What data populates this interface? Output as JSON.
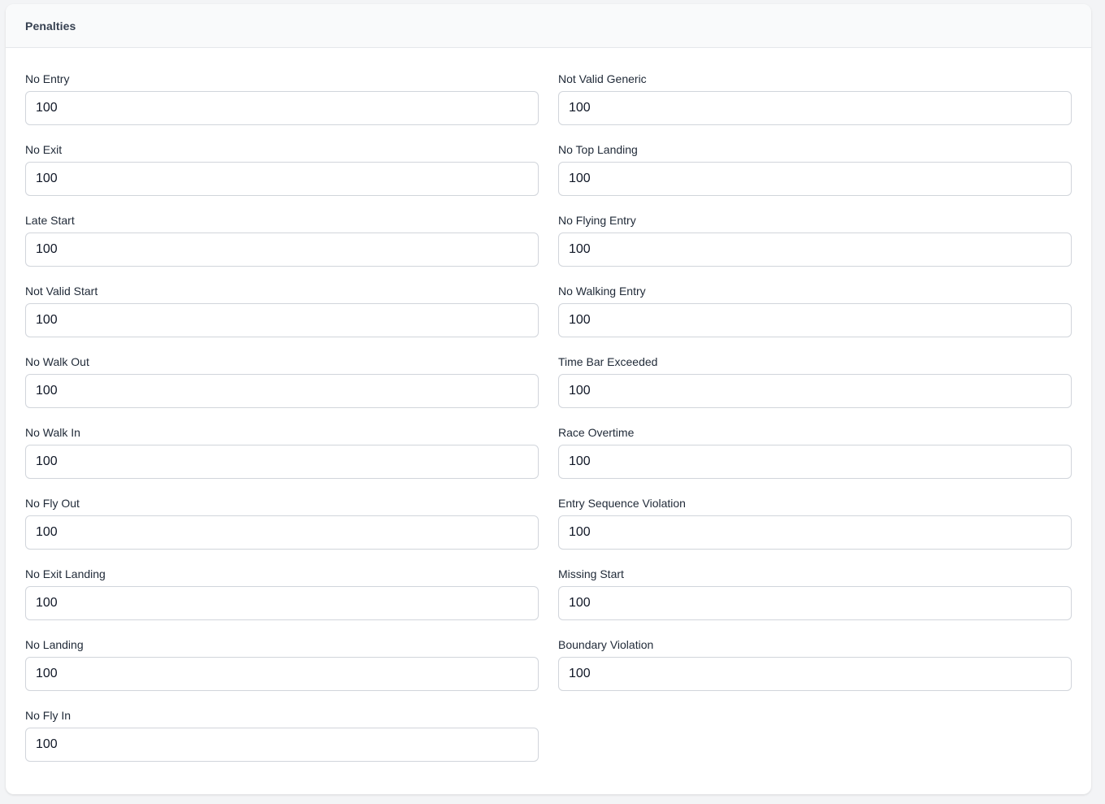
{
  "card": {
    "title": "Penalties"
  },
  "left_fields": [
    {
      "label": "No Entry",
      "value": "100"
    },
    {
      "label": "No Exit",
      "value": "100"
    },
    {
      "label": "Late Start",
      "value": "100"
    },
    {
      "label": "Not Valid Start",
      "value": "100"
    },
    {
      "label": "No Walk Out",
      "value": "100"
    },
    {
      "label": "No Walk In",
      "value": "100"
    },
    {
      "label": "No Fly Out",
      "value": "100"
    },
    {
      "label": "No Exit Landing",
      "value": "100"
    },
    {
      "label": "No Landing",
      "value": "100"
    },
    {
      "label": "No Fly In",
      "value": "100"
    }
  ],
  "right_fields": [
    {
      "label": "Not Valid Generic",
      "value": "100"
    },
    {
      "label": "No Top Landing",
      "value": "100"
    },
    {
      "label": "No Flying Entry",
      "value": "100"
    },
    {
      "label": "No Walking Entry",
      "value": "100"
    },
    {
      "label": "Time Bar Exceeded",
      "value": "100"
    },
    {
      "label": "Race Overtime",
      "value": "100"
    },
    {
      "label": "Entry Sequence Violation",
      "value": "100"
    },
    {
      "label": "Missing Start",
      "value": "100"
    },
    {
      "label": "Boundary Violation",
      "value": "100"
    }
  ]
}
